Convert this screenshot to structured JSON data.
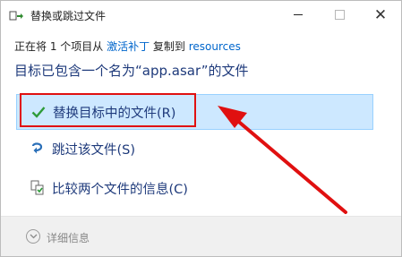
{
  "window": {
    "title": "替换或跳过文件"
  },
  "copy_info": {
    "prefix": "正在将 1 个项目从 ",
    "source": "激活补丁",
    "middle": " 复制到 ",
    "destination": "resources"
  },
  "heading": "目标已包含一个名为“app.asar”的文件",
  "options": {
    "replace": "替换目标中的文件(R)",
    "skip": "跳过该文件(S)",
    "compare": "比较两个文件的信息(C)"
  },
  "footer": {
    "details_label": "详细信息"
  },
  "colors": {
    "accent": "#0066cc",
    "selected_bg": "#cde8ff",
    "selected_border": "#99d1ff",
    "annotation_red": "#e01010",
    "heading_text": "#1e3a7b"
  },
  "icons": {
    "title": "copy-file-icon",
    "replace": "checkmark-icon",
    "skip": "skip-arrow-icon",
    "compare": "compare-files-icon",
    "details": "chevron-down-icon"
  }
}
